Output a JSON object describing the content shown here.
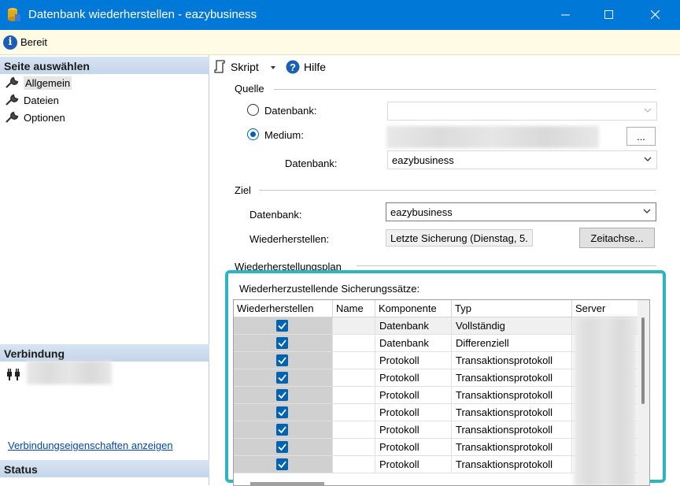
{
  "window": {
    "title": "Datenbank wiederherstellen - eazybusiness"
  },
  "statusbar": {
    "text": "Bereit"
  },
  "left": {
    "select_page_header": "Seite auswählen",
    "pages": [
      {
        "label": "Allgemein",
        "active": true
      },
      {
        "label": "Dateien",
        "active": false
      },
      {
        "label": "Optionen",
        "active": false
      }
    ],
    "connection_header": "Verbindung",
    "connection_link": "Verbindungseigenschaften anzeigen",
    "status_header": "Status"
  },
  "toolbar": {
    "script_label": "Skript",
    "help_label": "Hilfe"
  },
  "source": {
    "group_label": "Quelle",
    "database_radio_label": "Datenbank:",
    "medium_radio_label": "Medium:",
    "selected": "medium",
    "browse_label": "...",
    "database_label": "Datenbank:",
    "database_value": "eazybusiness"
  },
  "target": {
    "group_label": "Ziel",
    "database_label": "Datenbank:",
    "database_value": "eazybusiness",
    "restore_label": "Wiederherstellen:",
    "restore_value": "Letzte Sicherung (Dienstag, 5.",
    "timeline_button": "Zeitachse..."
  },
  "plan": {
    "group_label": "Wiederherstellungsplan",
    "sets_label": "Wiederherzustellende Sicherungssätze:",
    "columns": [
      "Wiederherstellen",
      "Name",
      "Komponente",
      "Typ",
      "Server"
    ],
    "rows": [
      {
        "restore": true,
        "name": "",
        "component": "Datenbank",
        "type": "Vollständig"
      },
      {
        "restore": true,
        "name": "",
        "component": "Datenbank",
        "type": "Differenziell"
      },
      {
        "restore": true,
        "name": "",
        "component": "Protokoll",
        "type": "Transaktionsprotokoll"
      },
      {
        "restore": true,
        "name": "",
        "component": "Protokoll",
        "type": "Transaktionsprotokoll"
      },
      {
        "restore": true,
        "name": "",
        "component": "Protokoll",
        "type": "Transaktionsprotokoll"
      },
      {
        "restore": true,
        "name": "",
        "component": "Protokoll",
        "type": "Transaktionsprotokoll"
      },
      {
        "restore": true,
        "name": "",
        "component": "Protokoll",
        "type": "Transaktionsprotokoll"
      },
      {
        "restore": true,
        "name": "",
        "component": "Protokoll",
        "type": "Transaktionsprotokoll"
      },
      {
        "restore": true,
        "name": "",
        "component": "Protokoll",
        "type": "Transaktionsprotokoll"
      }
    ]
  },
  "colors": {
    "titlebar": "#0078d7",
    "highlight_border": "#2cb5c0",
    "checkbox": "#0063b1"
  }
}
